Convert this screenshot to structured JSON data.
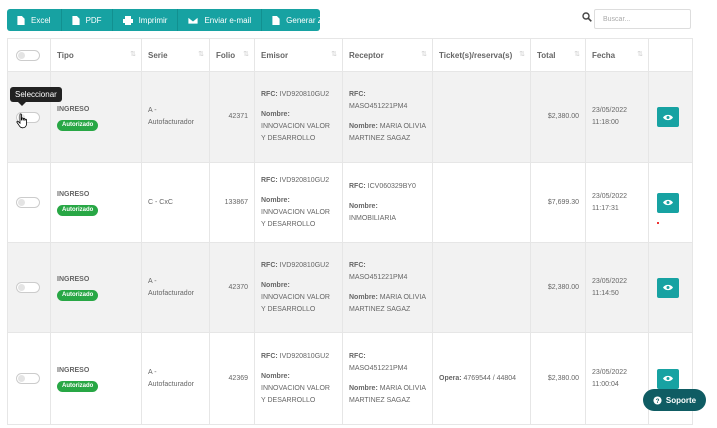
{
  "toolbar": {
    "excel": "Excel",
    "pdf": "PDF",
    "print": "Imprimir",
    "email": "Enviar e-mail",
    "zip": "Generar ZIP"
  },
  "search": {
    "placeholder": "Buscar..."
  },
  "colors": {
    "accent": "#17a2a2",
    "badge": "#28a745",
    "support": "#0f5c63"
  },
  "table": {
    "headers": [
      "Tipo",
      "Serie",
      "Folio",
      "Emisor",
      "Receptor",
      "Ticket(s)/reserva(s)",
      "Total",
      "Fecha"
    ],
    "rows": [
      {
        "tipo": "INGRESO",
        "status": "Autorizado",
        "serie": "A - Autofacturador",
        "folio": "42371",
        "emisor_rfc_label": "RFC:",
        "emisor_rfc": "IVD920810GU2",
        "emisor_nombre_label": "Nombre:",
        "emisor_nombre": "INNOVACION VALOR Y DESARROLLO",
        "receptor_rfc_label": "RFC:",
        "receptor_rfc": "MASO451221PM4",
        "receptor_nombre_label": "Nombre:",
        "receptor_nombre": "MARIA OLIVIA MARTINEZ SAGAZ",
        "ticket": "",
        "total": "$2,380.00",
        "fecha": "23/05/2022",
        "hora": "11:18:00"
      },
      {
        "tipo": "INGRESO",
        "status": "Autorizado",
        "serie": "C - CxC",
        "folio": "133867",
        "emisor_rfc_label": "RFC:",
        "emisor_rfc": "IVD920810GU2",
        "emisor_nombre_label": "Nombre:",
        "emisor_nombre": "INNOVACION VALOR Y DESARROLLO",
        "receptor_rfc_label": "RFC:",
        "receptor_rfc": "ICV060329BY0",
        "receptor_nombre_label": "Nombre:",
        "receptor_nombre": "INMOBILIARIA",
        "ticket": "",
        "total": "$7,699.30",
        "fecha": "23/05/2022",
        "hora": "11:17:31"
      },
      {
        "tipo": "INGRESO",
        "status": "Autorizado",
        "serie": "A - Autofacturador",
        "folio": "42370",
        "emisor_rfc_label": "RFC:",
        "emisor_rfc": "IVD920810GU2",
        "emisor_nombre_label": "Nombre:",
        "emisor_nombre": "INNOVACION VALOR Y DESARROLLO",
        "receptor_rfc_label": "RFC:",
        "receptor_rfc": "MASO451221PM4",
        "receptor_nombre_label": "Nombre:",
        "receptor_nombre": "MARIA OLIVIA MARTINEZ SAGAZ",
        "ticket": "",
        "total": "$2,380.00",
        "fecha": "23/05/2022",
        "hora": "11:14:50"
      },
      {
        "tipo": "INGRESO",
        "status": "Autorizado",
        "serie": "A - Autofacturador",
        "folio": "42369",
        "emisor_rfc_label": "RFC:",
        "emisor_rfc": "IVD920810GU2",
        "emisor_nombre_label": "Nombre:",
        "emisor_nombre": "INNOVACION VALOR Y DESARROLLO",
        "receptor_rfc_label": "RFC:",
        "receptor_rfc": "MASO451221PM4",
        "receptor_nombre_label": "Nombre:",
        "receptor_nombre": "MARIA OLIVIA MARTINEZ SAGAZ",
        "ticket_label": "Opera:",
        "ticket": "4769544 / 44804",
        "total": "$2,380.00",
        "fecha": "23/05/2022",
        "hora": "11:00:04"
      }
    ]
  },
  "tooltip": "Seleccionar",
  "support": {
    "label": "Soporte"
  }
}
